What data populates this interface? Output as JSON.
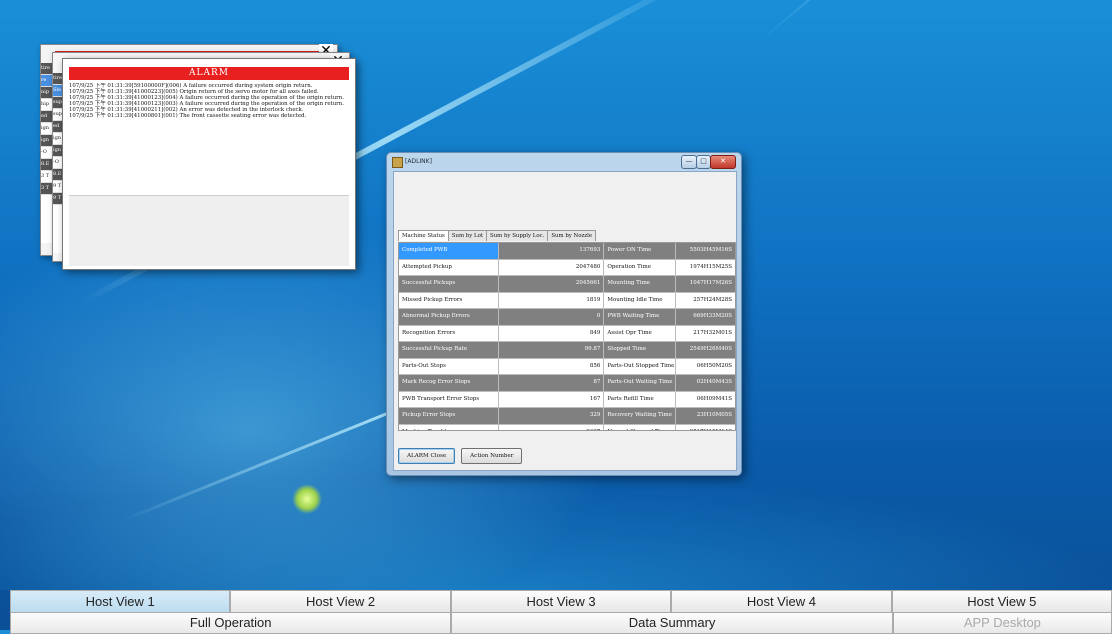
{
  "alarm_windows": {
    "title": "ALARM",
    "log_lines": [
      "107/9/25 下午 01:31:39[59100000F](006) A failure occurred during system origin return.",
      "107/9/25 下午 01:31:39[41000223](005) Origin return of the servo motor for all axes failed.",
      "107/9/25 下午 01:31:39[41000123](004) A failure occurred during the operation of the origin return.",
      "107/9/25 下午 01:31:39[41000123](003) A failure occurred during the operation of the origin return.",
      "107/9/25 下午 01:31:39[41000211](002) An error was detected in the interlock check.",
      "107/9/25 下午 01:31:39[41000801](001) The front cassette seating error was detected."
    ],
    "close_glyph": "✕",
    "left_strip": [
      "tire",
      "re",
      "nip",
      "hip",
      "ed",
      "ign",
      "ign",
      "-O",
      "8.E",
      "3 T",
      "3 T"
    ],
    "left_strip2": [
      "tire",
      "Sle",
      "sup",
      "sup",
      "ed",
      "ign",
      "ign",
      "-O",
      "8.E",
      "9 T",
      "9 T"
    ]
  },
  "adlink": {
    "title": "[ADLINK]",
    "buttons": {
      "minimize": "—",
      "maximize": "□",
      "close": "✕"
    },
    "tabs": [
      "Machine Status",
      "Sum by Lot",
      "Sum by Supply Loc.",
      "Sum by Nozzle"
    ],
    "rows": [
      {
        "label": "Completed PWB",
        "value": "137693",
        "label2": "Power ON Time",
        "value2": "5503H45M16S"
      },
      {
        "label": "Attempted Pickup",
        "value": "2047480",
        "label2": "Operation Time",
        "value2": "1974H15M25S"
      },
      {
        "label": "Successful Pickups",
        "value": "2045661",
        "label2": "Mounting Time",
        "value2": "1047H17M26S"
      },
      {
        "label": "Missed Pickup Errors",
        "value": "1819",
        "label2": "Mounting Idle Time",
        "value2": "257H24M28S"
      },
      {
        "label": "Abnormal Pickup Errors",
        "value": "0",
        "label2": "PWB Waiting Time",
        "value2": "669H33M20S"
      },
      {
        "label": "Recognition Errors",
        "value": "849",
        "label2": "Assist Opr Time",
        "value2": "217H32M01S"
      },
      {
        "label": "Successful Pickup Rate",
        "value": "99.87",
        "label2": "Stopped Time",
        "value2": "2549H26M40S"
      },
      {
        "label": "Parts-Out Stops",
        "value": "856",
        "label2": "Parts-Out Stopped Time",
        "value2": "06H50M20S"
      },
      {
        "label": "Mark Recog Error Stops",
        "value": "87",
        "label2": "Parts-Out Waiting Time",
        "value2": "02H40M43S"
      },
      {
        "label": "PWB Transport Error Stops",
        "value": "167",
        "label2": "Parts Refill Time",
        "value2": "06H09M41S"
      },
      {
        "label": "Pickup Error Stops",
        "value": "329",
        "label2": "Recovery Waiting Time",
        "value2": "23H10M05S"
      },
      {
        "label": "Machine Troubles",
        "value": "2627",
        "label2": "Normal Stopped Time",
        "value2": "2517H18M14S"
      }
    ],
    "action_buttons": [
      "ALARM Close",
      "Action Number"
    ]
  },
  "host_views": [
    "Host View 1",
    "Host View 2",
    "Host View 3",
    "Host View 4",
    "Host View 5"
  ],
  "operations": {
    "full_operation": "Full Operation",
    "data_summary": "Data Summary",
    "app_desktop": "APP Desktop"
  },
  "colors": {
    "alarm_red": "#e82020",
    "selection_blue": "#3399ff",
    "row_dark": "#808080"
  }
}
